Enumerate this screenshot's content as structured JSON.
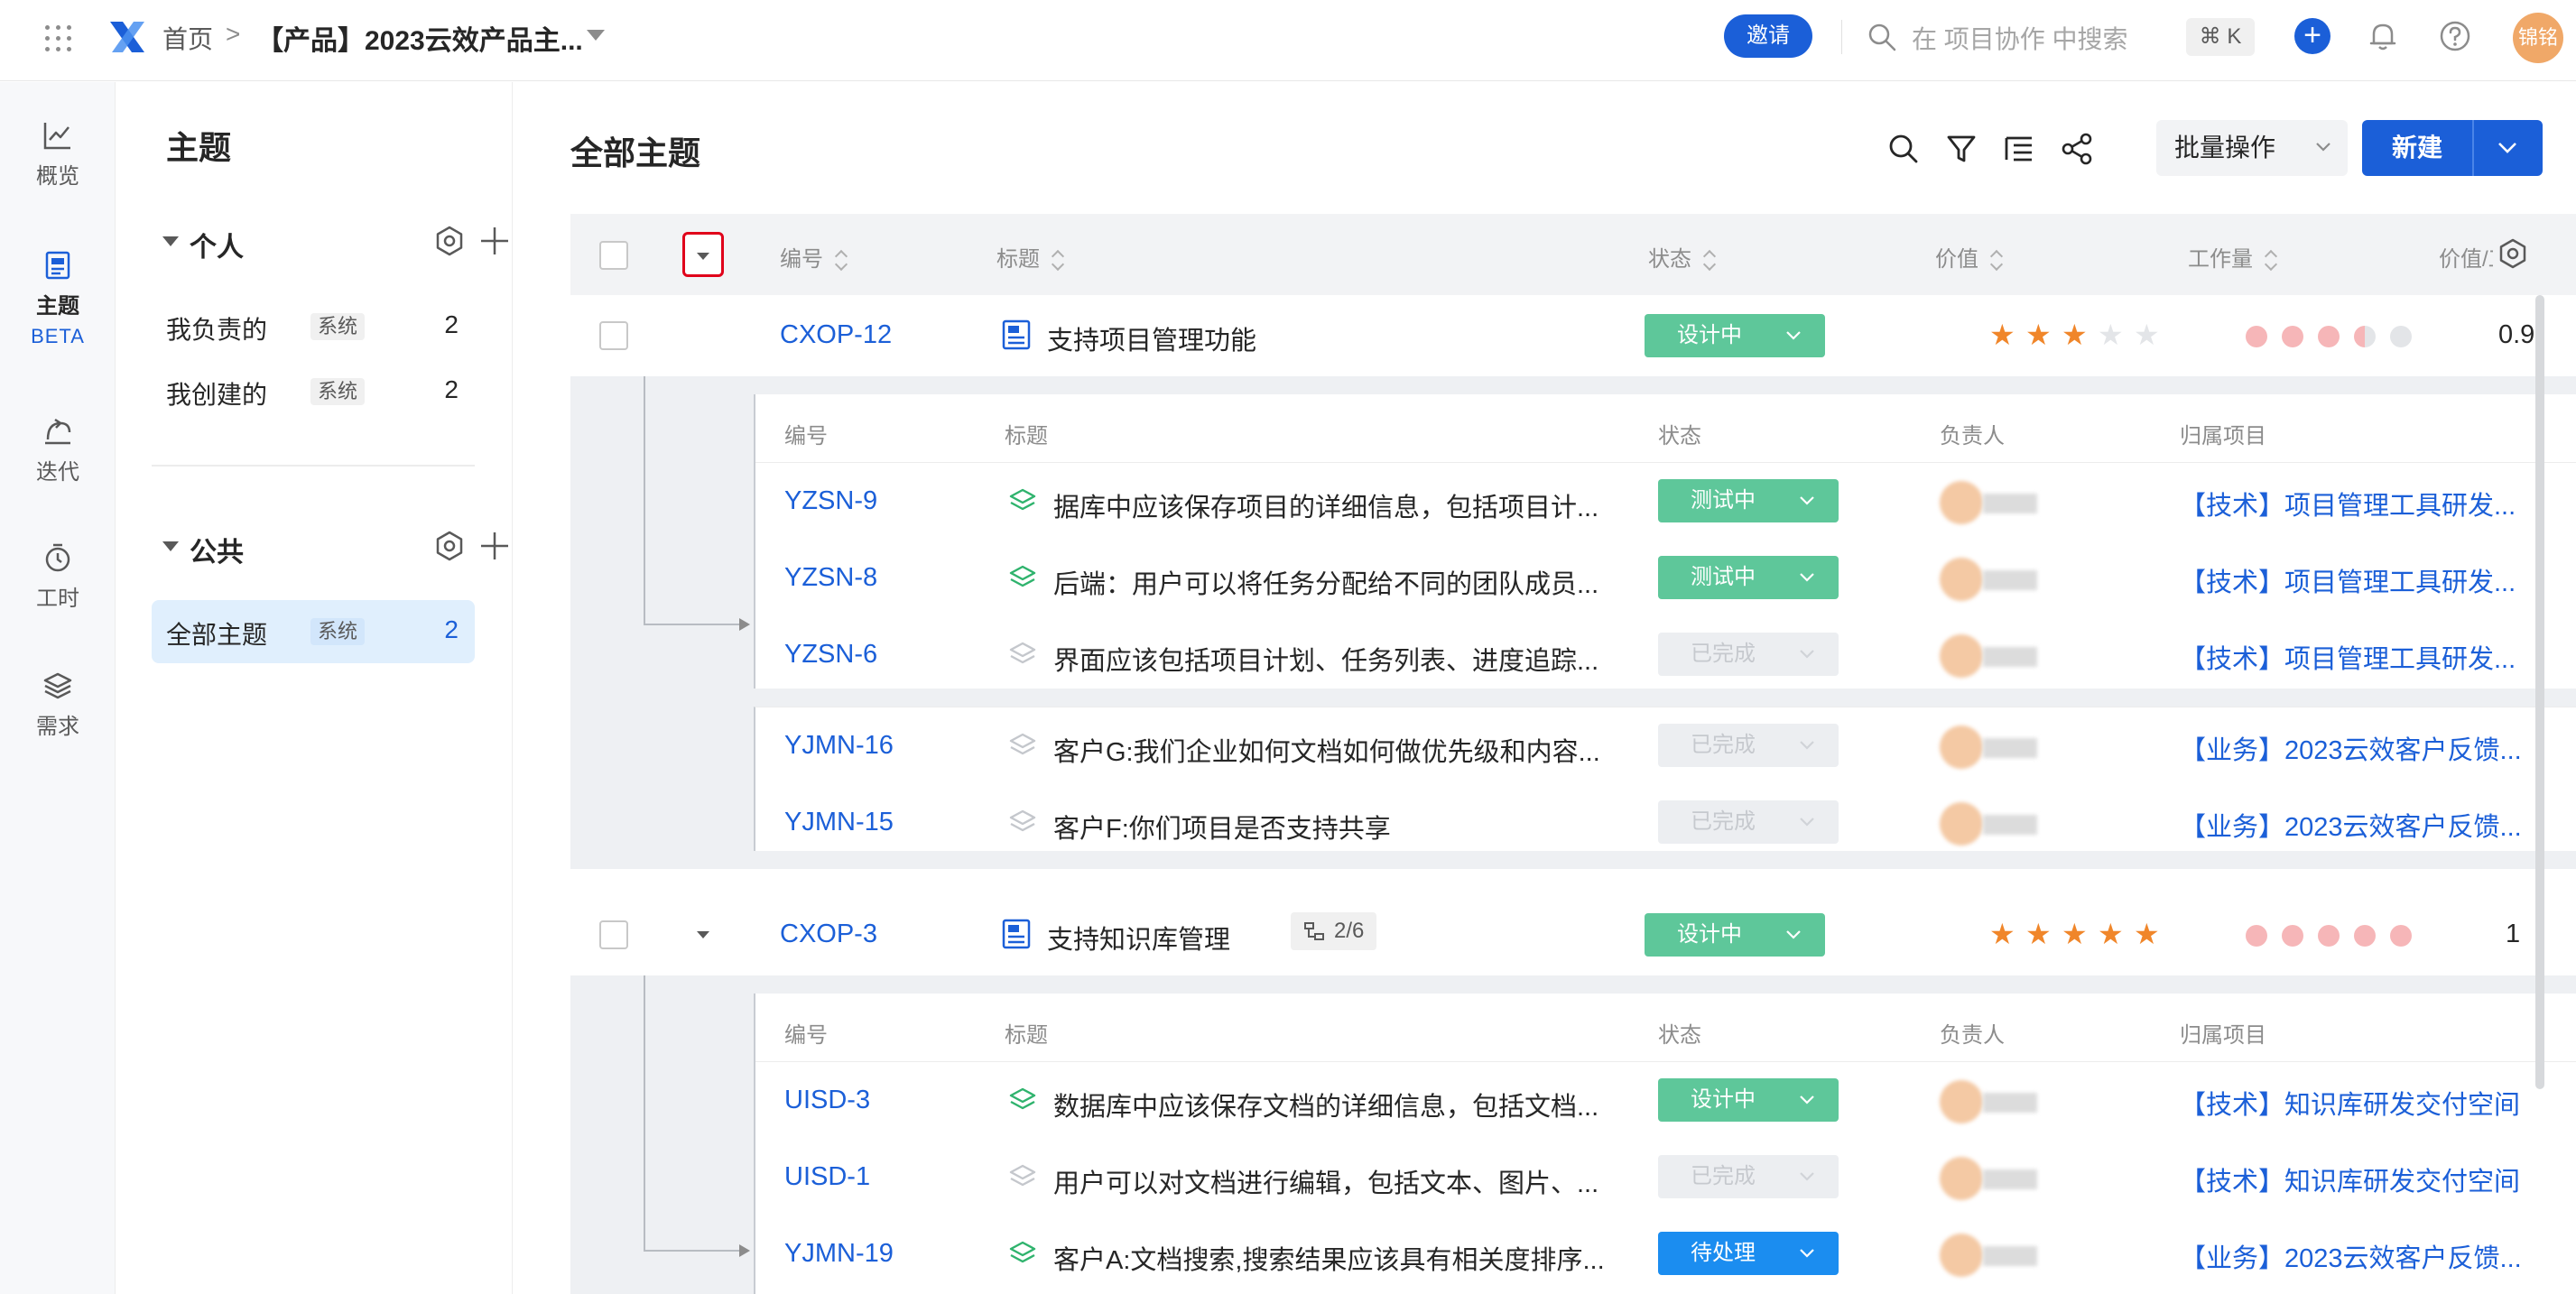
{
  "topbar": {
    "home": "首页",
    "separator": ">",
    "project": "【产品】2023云效产品主...",
    "invite": "邀请",
    "search_placeholder": "在 项目协作 中搜索",
    "shortcut": "⌘ K",
    "avatar_text": "锦铭"
  },
  "rail": {
    "items": [
      {
        "label": "概览",
        "icon": "chart-line-icon"
      },
      {
        "label": "主题",
        "icon": "document-icon",
        "active": true,
        "badge": "BETA"
      },
      {
        "label": "迭代",
        "icon": "iteration-icon"
      },
      {
        "label": "工时",
        "icon": "timer-icon"
      },
      {
        "label": "需求",
        "icon": "layers-icon"
      }
    ]
  },
  "side": {
    "title": "主题",
    "groups": [
      {
        "name": "个人",
        "items": [
          {
            "label": "我负责的",
            "tag": "系统",
            "count": "2"
          },
          {
            "label": "我创建的",
            "tag": "系统",
            "count": "2"
          }
        ]
      },
      {
        "name": "公共",
        "items": [
          {
            "label": "全部主题",
            "tag": "系统",
            "count": "2",
            "active": true
          }
        ]
      }
    ]
  },
  "main": {
    "title": "全部主题",
    "batch": "批量操作",
    "new": "新建",
    "columns": [
      "编号",
      "标题",
      "状态",
      "价值",
      "工作量",
      "价值/工"
    ],
    "sub_columns": [
      "编号",
      "标题",
      "状态",
      "负责人",
      "归属项目"
    ],
    "rows": [
      {
        "code": "CXOP-12",
        "title": "支持项目管理功能",
        "status": "设计中",
        "value_stars": 3,
        "workload_dots": 3.5,
        "ratio": "0.9",
        "children": [
          {
            "code": "YZSN-9",
            "title": "据库中应该保存项目的详细信息，包括项目计...",
            "status": "测试中",
            "project": "【技术】项目管理工具研发..."
          },
          {
            "code": "YZSN-8",
            "title": "后端：用户可以将任务分配给不同的团队成员...",
            "status": "测试中",
            "project": "【技术】项目管理工具研发..."
          },
          {
            "code": "YZSN-6",
            "title": "界面应该包括项目计划、任务列表、进度追踪...",
            "status": "已完成",
            "project": "【技术】项目管理工具研发..."
          },
          {
            "code": "YJMN-16",
            "title": "客户G:我们企业如何文档如何做优先级和内容...",
            "status": "已完成",
            "project": "【业务】2023云效客户反馈..."
          },
          {
            "code": "YJMN-15",
            "title": "客户F:你们项目是否支持共享",
            "status": "已完成",
            "project": "【业务】2023云效客户反馈..."
          }
        ]
      },
      {
        "code": "CXOP-3",
        "title": "支持知识库管理",
        "sub_progress": "2/6",
        "status": "设计中",
        "value_stars": 5,
        "workload_dots": 5,
        "ratio": "1",
        "children": [
          {
            "code": "UISD-3",
            "title": "数据库中应该保存文档的详细信息，包括文档...",
            "status": "设计中",
            "project": "【技术】知识库研发交付空间"
          },
          {
            "code": "UISD-1",
            "title": "用户可以对文档进行编辑，包括文本、图片、...",
            "status": "已完成",
            "project": "【技术】知识库研发交付空间"
          },
          {
            "code": "YJMN-19",
            "title": "客户A:文档搜索,搜索结果应该具有相关度排序...",
            "status": "待处理",
            "project": "【业务】2023云效客户反馈..."
          }
        ]
      }
    ]
  },
  "colors": {
    "brand": "#1b5fd8",
    "status_green": "#5ec79a",
    "status_blue": "#1b8df0",
    "status_grey": "#eceef1",
    "star": "#f0862a",
    "dot": "#f6b6b8"
  }
}
